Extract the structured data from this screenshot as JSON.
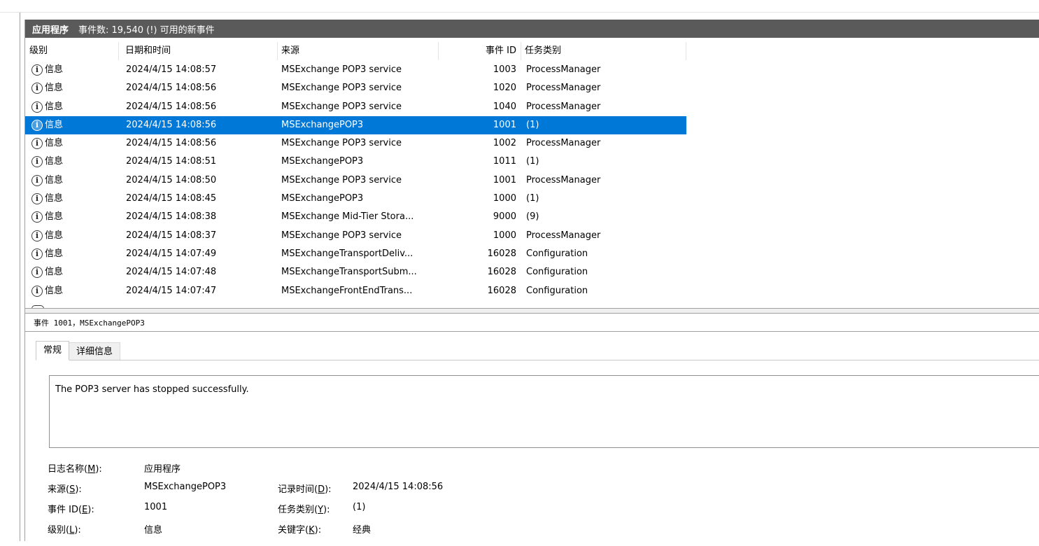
{
  "panel": {
    "log_name": "应用程序",
    "event_count": "事件数: 19,540 (!) 可用的新事件"
  },
  "columns": {
    "level": "级别",
    "date": "日期和时间",
    "source": "来源",
    "event_id": "事件 ID",
    "task": "任务类别"
  },
  "events": [
    {
      "level": "信息",
      "date": "2024/4/15 14:08:57",
      "source": "MSExchange POP3 service",
      "id": "1003",
      "task": "ProcessManager"
    },
    {
      "level": "信息",
      "date": "2024/4/15 14:08:56",
      "source": "MSExchange POP3 service",
      "id": "1020",
      "task": "ProcessManager"
    },
    {
      "level": "信息",
      "date": "2024/4/15 14:08:56",
      "source": "MSExchange POP3 service",
      "id": "1040",
      "task": "ProcessManager"
    },
    {
      "level": "信息",
      "date": "2024/4/15 14:08:56",
      "source": "MSExchangePOP3",
      "id": "1001",
      "task": "(1)"
    },
    {
      "level": "信息",
      "date": "2024/4/15 14:08:56",
      "source": "MSExchange POP3 service",
      "id": "1002",
      "task": "ProcessManager"
    },
    {
      "level": "信息",
      "date": "2024/4/15 14:08:51",
      "source": "MSExchangePOP3",
      "id": "1011",
      "task": "(1)"
    },
    {
      "level": "信息",
      "date": "2024/4/15 14:08:50",
      "source": "MSExchange POP3 service",
      "id": "1001",
      "task": "ProcessManager"
    },
    {
      "level": "信息",
      "date": "2024/4/15 14:08:45",
      "source": "MSExchangePOP3",
      "id": "1000",
      "task": "(1)"
    },
    {
      "level": "信息",
      "date": "2024/4/15 14:08:38",
      "source": "MSExchange Mid-Tier Stora...",
      "id": "9000",
      "task": "(9)"
    },
    {
      "level": "信息",
      "date": "2024/4/15 14:08:37",
      "source": "MSExchange POP3 service",
      "id": "1000",
      "task": "ProcessManager"
    },
    {
      "level": "信息",
      "date": "2024/4/15 14:07:49",
      "source": "MSExchangeTransportDeliv...",
      "id": "16028",
      "task": "Configuration"
    },
    {
      "level": "信息",
      "date": "2024/4/15 14:07:48",
      "source": "MSExchangeTransportSubm...",
      "id": "16028",
      "task": "Configuration"
    },
    {
      "level": "信息",
      "date": "2024/4/15 14:07:47",
      "source": "MSExchangeFrontEndTrans...",
      "id": "16028",
      "task": "Configuration"
    }
  ],
  "selected_index": 3,
  "detail": {
    "title": "事件 1001，MSExchangePOP3",
    "tabs": [
      "常规",
      "详细信息"
    ],
    "active_tab": "常规",
    "description": "The POP3 server has stopped successfully.",
    "fields": {
      "log_name_label": "日志名称",
      "log_name_key": "M",
      "log_name_value": "应用程序",
      "source_label": "来源",
      "source_key": "S",
      "source_value": "MSExchangePOP3",
      "logged_label": "记录时间",
      "logged_key": "D",
      "logged_value": "2024/4/15 14:08:56",
      "event_id_label": "事件 ID",
      "event_id_key": "E",
      "event_id_value": "1001",
      "task_label": "任务类别",
      "task_key": "Y",
      "task_value": "(1)",
      "level_label": "级别",
      "level_key": "L",
      "level_value": "信息",
      "keywords_label": "关键字",
      "keywords_key": "K",
      "keywords_value": "经典"
    }
  },
  "colors": {
    "selection": "#0078d7",
    "title_bar": "#5a5a5a"
  }
}
